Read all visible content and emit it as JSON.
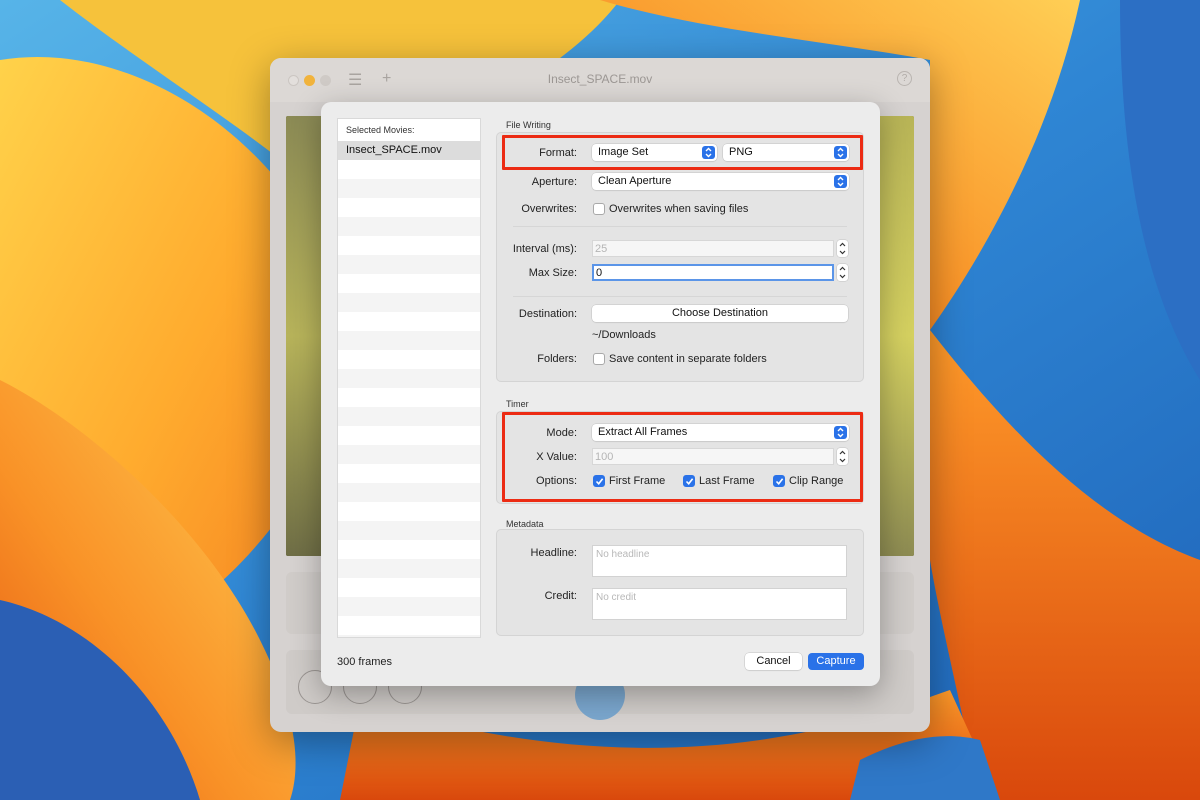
{
  "window": {
    "title": "Insect_SPACE.mov",
    "help_glyph": "?",
    "list_glyph": "☰",
    "add_glyph": "+"
  },
  "dialog": {
    "movie_list": {
      "header": "Selected Movies:",
      "items": [
        "Insect_SPACE.mov"
      ]
    },
    "frame_count": "300 frames",
    "file_writing": {
      "section_title": "File Writing",
      "format_label": "Format:",
      "format_value": "Image Set",
      "format_type_value": "PNG",
      "aperture_label": "Aperture:",
      "aperture_value": "Clean Aperture",
      "overwrites_label": "Overwrites:",
      "overwrites_checkbox_label": "Overwrites when saving files",
      "overwrites_checked": false,
      "interval_label": "Interval (ms):",
      "interval_value": "25",
      "max_size_label": "Max Size:",
      "max_size_value": "0",
      "destination_label": "Destination:",
      "destination_button": "Choose Destination",
      "destination_path": "~/Downloads",
      "folders_label": "Folders:",
      "folders_checkbox_label": "Save content in separate folders",
      "folders_checked": false
    },
    "timer": {
      "section_title": "Timer",
      "mode_label": "Mode:",
      "mode_value": "Extract All Frames",
      "x_value_label": "X Value:",
      "x_value": "100",
      "options_label": "Options:",
      "options": [
        {
          "label": "First Frame",
          "checked": true
        },
        {
          "label": "Last Frame",
          "checked": true
        },
        {
          "label": "Clip Range",
          "checked": true
        }
      ]
    },
    "metadata": {
      "section_title": "Metadata",
      "headline_label": "Headline:",
      "headline_placeholder": "No headline",
      "credit_label": "Credit:",
      "credit_placeholder": "No credit"
    },
    "buttons": {
      "cancel": "Cancel",
      "capture": "Capture"
    }
  },
  "colors": {
    "accent": "#2a72e8",
    "highlight": "#ec2b13",
    "sheet_background": "#ececec"
  },
  "icons": {
    "popup": "chevron-up-down-icon",
    "checkbox": "checkmark-icon",
    "help": "question-icon"
  }
}
